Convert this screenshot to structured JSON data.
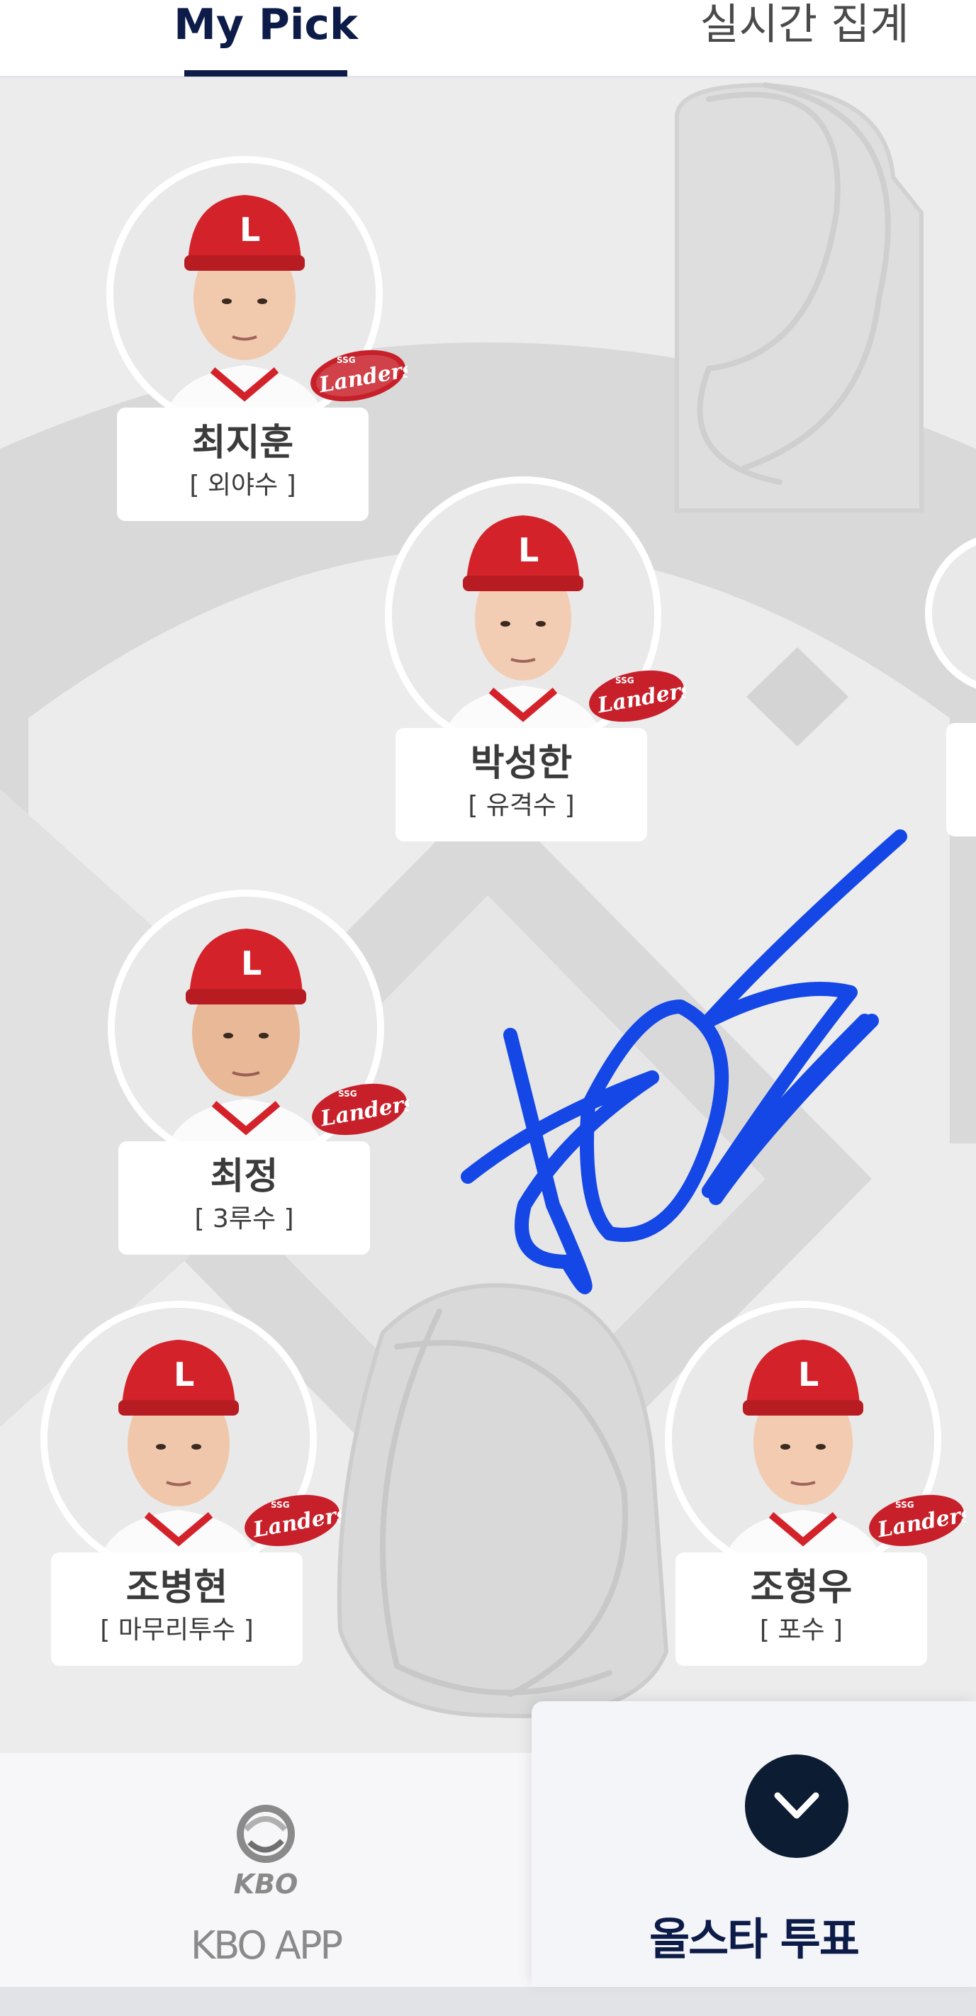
{
  "tabs": {
    "my_pick": "My Pick",
    "live_tally": "실시간 집계"
  },
  "players": [
    {
      "name": "최지훈",
      "position": "[ 외야수 ]"
    },
    {
      "name": "박성한",
      "position": "[ 유격수 ]"
    },
    {
      "name": "최정",
      "position": "[ 3루수 ]"
    },
    {
      "name": "조병현",
      "position": "[ 마무리투수 ]"
    },
    {
      "name": "조형우",
      "position": "[ 포수 ]"
    }
  ],
  "team_logo_text": "Landers",
  "team_logo_small": "SSG",
  "cap_letter": "L",
  "bottom_nav": {
    "kbo_logo_text": "KBO",
    "kbo_app_label": "KBO APP",
    "vote_label": "올스타 투표"
  },
  "colors": {
    "accent_navy": "#0d1b48",
    "cap_red": "#d3222a",
    "doodle_blue": "#1447e6"
  }
}
